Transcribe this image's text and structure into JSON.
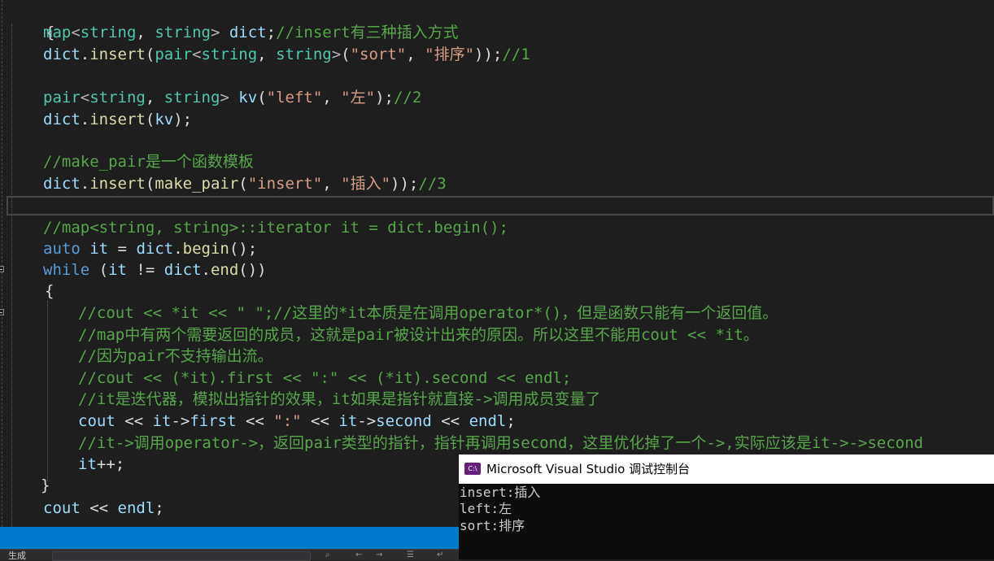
{
  "editor": {
    "open_brace": "{",
    "lines": {
      "l1": {
        "type1": "map",
        "lt": "<",
        "type2": "string",
        "comma": ", ",
        "type3": "string",
        "gt": ">",
        "sp": " ",
        "var": "dict",
        "semi": ";",
        "comment": "//insert有三种插入方式"
      },
      "l2": {
        "var": "dict",
        "dot": ".",
        "func": "insert",
        "p1": "(",
        "type1": "pair",
        "lt": "<",
        "type2": "string",
        "comma": ", ",
        "type3": "string",
        "gt": ">",
        "p2": "(",
        "str1": "\"sort\"",
        "comma2": ", ",
        "str2": "\"排序\"",
        "p3": "));",
        "comment": "//1"
      },
      "l3": {
        "type1": "pair",
        "lt": "<",
        "type2": "string",
        "comma": ", ",
        "type3": "string",
        "gt": ">",
        "sp": " ",
        "var": "kv",
        "p1": "(",
        "str1": "\"left\"",
        "comma2": ", ",
        "str2": "\"左\"",
        "p2": ");",
        "comment": "//2"
      },
      "l4": {
        "var": "dict",
        "dot": ".",
        "func": "insert",
        "p1": "(",
        "var2": "kv",
        "p2": ");"
      },
      "l5": {
        "comment": "//make_pair是一个函数模板"
      },
      "l6": {
        "var": "dict",
        "dot": ".",
        "func": "insert",
        "p1": "(",
        "func2": "make_pair",
        "p2": "(",
        "str1": "\"insert\"",
        "comma": ", ",
        "str2": "\"插入\"",
        "p3": "));",
        "comment": "//3"
      },
      "l7": {
        "comment": "//map<string, string>::iterator it = dict.begin();"
      },
      "l8": {
        "kw": "auto",
        "sp": " ",
        "var": "it",
        "eq": " = ",
        "var2": "dict",
        "dot": ".",
        "func": "begin",
        "p": "();"
      },
      "l9": {
        "kw": "while",
        "p1": " (",
        "var": "it",
        "op": " != ",
        "var2": "dict",
        "dot": ".",
        "func": "end",
        "p2": "())"
      },
      "l10": {
        "brace": "{"
      },
      "l11": {
        "comment": "//cout << *it << \" \";//这里的*it本质是在调用operator*()，但是函数只能有一个返回值。"
      },
      "l12": {
        "comment": "//map中有两个需要返回的成员，这就是pair被设计出来的原因。所以这里不能用cout << *it。"
      },
      "l13": {
        "comment": "//因为pair不支持输出流。"
      },
      "l14": {
        "comment": "//cout << (*it).first << \":\" << (*it).second << endl;"
      },
      "l15": {
        "comment": "//it是迭代器，模拟出指针的效果，it如果是指针就直接->调用成员变量了"
      },
      "l16": {
        "var": "cout",
        "op1": " << ",
        "var2": "it",
        "arrow1": "->",
        "var3": "first",
        "op2": " << ",
        "str": "\":\"",
        "op3": " << ",
        "var4": "it",
        "arrow2": "->",
        "var5": "second",
        "op4": " << ",
        "var6": "endl",
        "semi": ";"
      },
      "l17": {
        "comment": "//it->调用operator->，返回pair类型的指针，指针再调用second，这里优化掉了一个->,实际应该是it->->second"
      },
      "l18": {
        "var": "it",
        "op": "++",
        "semi": ";"
      },
      "l19": {
        "brace": "}"
      },
      "l20": {
        "var": "cout",
        "op": " << ",
        "var2": "endl",
        "semi": ";"
      }
    }
  },
  "bottom_panel": {
    "label": "生成"
  },
  "console": {
    "icon_text": "C:\\",
    "title": "Microsoft Visual Studio 调试控制台",
    "output": [
      "insert:插入",
      "left:左",
      "sort:排序"
    ]
  }
}
